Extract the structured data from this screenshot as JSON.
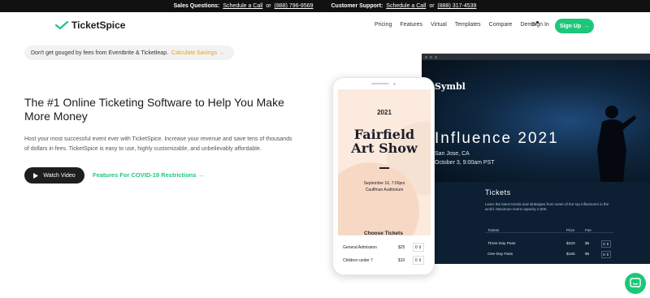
{
  "topbar": {
    "sales_label": "Sales Questions:",
    "sales_link": "Schedule a Call",
    "or1": "or",
    "sales_phone": "(888) 796-9569",
    "support_label": "Customer Support:",
    "support_link": "Schedule a Call",
    "or2": "or",
    "support_phone": "(888) 317-4539"
  },
  "nav": {
    "logo": "TicketSpice",
    "links": [
      "Pricing",
      "Features",
      "Virtual",
      "Templates",
      "Compare",
      "Demo"
    ],
    "sign_in": "Sign In",
    "sign_up": "Sign Up"
  },
  "promo": {
    "text": "Don't get gouged by fees from Eventbrite & Ticketleap.",
    "cta": "Calculate Savings"
  },
  "hero": {
    "title": "The #1 Online Ticketing Software to Help You Make More Money",
    "description": "Host your most successful event ever with TicketSpice. Increase your revenue and save tens of thousands of dollars in fees. TicketSpice is easy to use, highly customizable, and unbelievably affordable.",
    "watch_video": "Watch Video",
    "covid_link": "Features For COVID-19 Restrictions"
  },
  "desktop_mockup": {
    "brand": "Symbl",
    "event_title": "Influence 2021",
    "location": "San Jose, CA",
    "datetime": "October 3, 9:00am PST",
    "tickets_title": "Tickets",
    "tickets_desc": "Learn the latest trends and strategies from some of the top influencers in the world. Maximum event capacity 2,500.",
    "headers": {
      "name": "Tickets",
      "price": "Price",
      "fee": "Fee"
    },
    "rows": [
      {
        "name": "Three Day Pass",
        "price": "$320",
        "fee": "$5",
        "qty": "0"
      },
      {
        "name": "One-Day Pass",
        "price": "$165",
        "fee": "$5",
        "qty": "0"
      }
    ]
  },
  "phone_mockup": {
    "year": "2021",
    "title_line1": "Fairfield",
    "title_line2": "Art Show",
    "date": "September 16, 7:00pm",
    "venue": "Cauffman Auditorium",
    "choose": "Choose Tickets",
    "rows": [
      {
        "name": "General Admission",
        "price": "$25",
        "qty": "0"
      },
      {
        "name": "Children under 7",
        "price": "$10",
        "qty": "0"
      }
    ]
  },
  "colors": {
    "brand_green": "#1dc77a",
    "promo_orange": "#e9a21c"
  }
}
